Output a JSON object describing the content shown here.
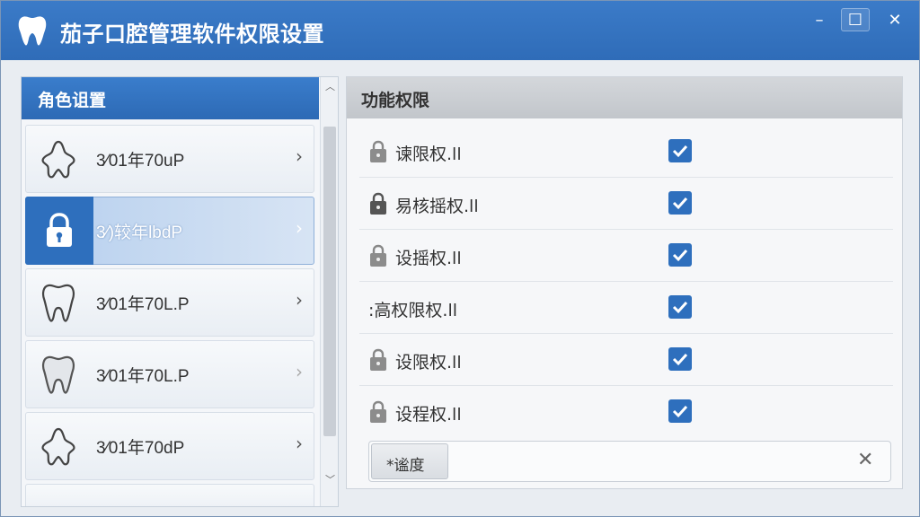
{
  "window": {
    "title": "茄子口腔管理软件权限设置",
    "controls": {
      "minimize": "–",
      "maximize": "☐",
      "close": "✕"
    }
  },
  "roles": {
    "header": "角色诅置",
    "items": [
      {
        "label": "3⁄01年70uP",
        "icon": "tooth-root-icon",
        "selected": false
      },
      {
        "label": "3⁄)较年lbdP",
        "icon": "lock-icon",
        "selected": true
      },
      {
        "label": "3⁄01年70L.P",
        "icon": "tooth-icon",
        "selected": false
      },
      {
        "label": "3⁄01年70L.P",
        "icon": "tooth-icon",
        "selected": false
      },
      {
        "label": "3⁄01年70dP",
        "icon": "tooth-root-icon",
        "selected": false
      }
    ],
    "chevron": "›",
    "scroll_up": "︿",
    "scroll_down": "﹀"
  },
  "permissions": {
    "header": "功能权限",
    "items": [
      {
        "label": "谏限权.ll",
        "checked": true
      },
      {
        "label": "易核摇权.ll",
        "checked": true
      },
      {
        "label": "设摇权.ll",
        "checked": true
      },
      {
        "label": ":高权限权.ll",
        "checked": true
      },
      {
        "label": "设限权.ll",
        "checked": true
      },
      {
        "label": "设程权.ll",
        "checked": true
      }
    ],
    "check_glyph": "✓"
  },
  "filter": {
    "button_label": "*谧度",
    "value": "",
    "clear": "✕"
  },
  "colors": {
    "accent": "#2e6fbd",
    "titlebar": "#3472bf"
  }
}
